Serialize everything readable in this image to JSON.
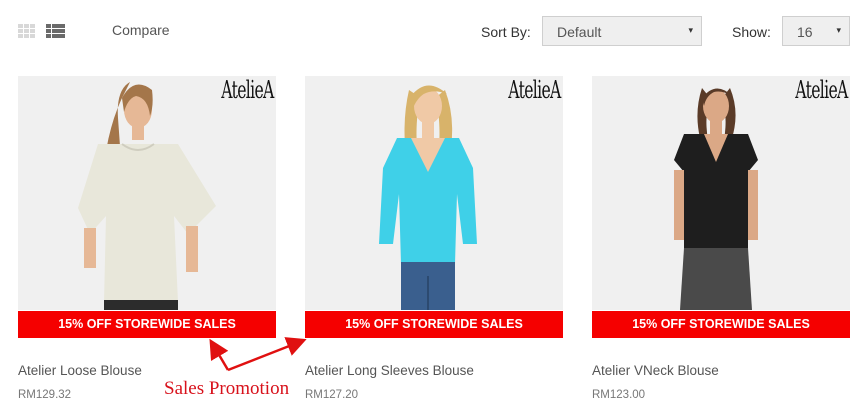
{
  "toolbar": {
    "grid_view_icon": "grid-icon",
    "list_view_icon": "list-icon",
    "compare_label": "Compare",
    "sort_label": "Sort By:",
    "sort_value": "Default",
    "show_label": "Show:",
    "show_value": "16",
    "caret": "▾"
  },
  "products": [
    {
      "brand": "AtelieA",
      "promo": "15% OFF STOREWIDE SALES",
      "name": "Atelier Loose Blouse",
      "price": "RM129.32",
      "top_color": "#e8e7da"
    },
    {
      "brand": "AtelieA",
      "promo": "15% OFF STOREWIDE SALES",
      "name": "Atelier Long Sleeves Blouse",
      "price": "RM127.20",
      "top_color": "#3fd0e8"
    },
    {
      "brand": "AtelieA",
      "promo": "15% OFF STOREWIDE SALES",
      "name": "Atelier VNeck Blouse",
      "price": "RM123.00",
      "top_color": "#1e1e1e"
    }
  ],
  "annotation": {
    "label": "Sales Promotion",
    "color": "#e01010"
  },
  "colors": {
    "promo_banner": "#f50000",
    "photo_bg": "#f0f0f0"
  }
}
